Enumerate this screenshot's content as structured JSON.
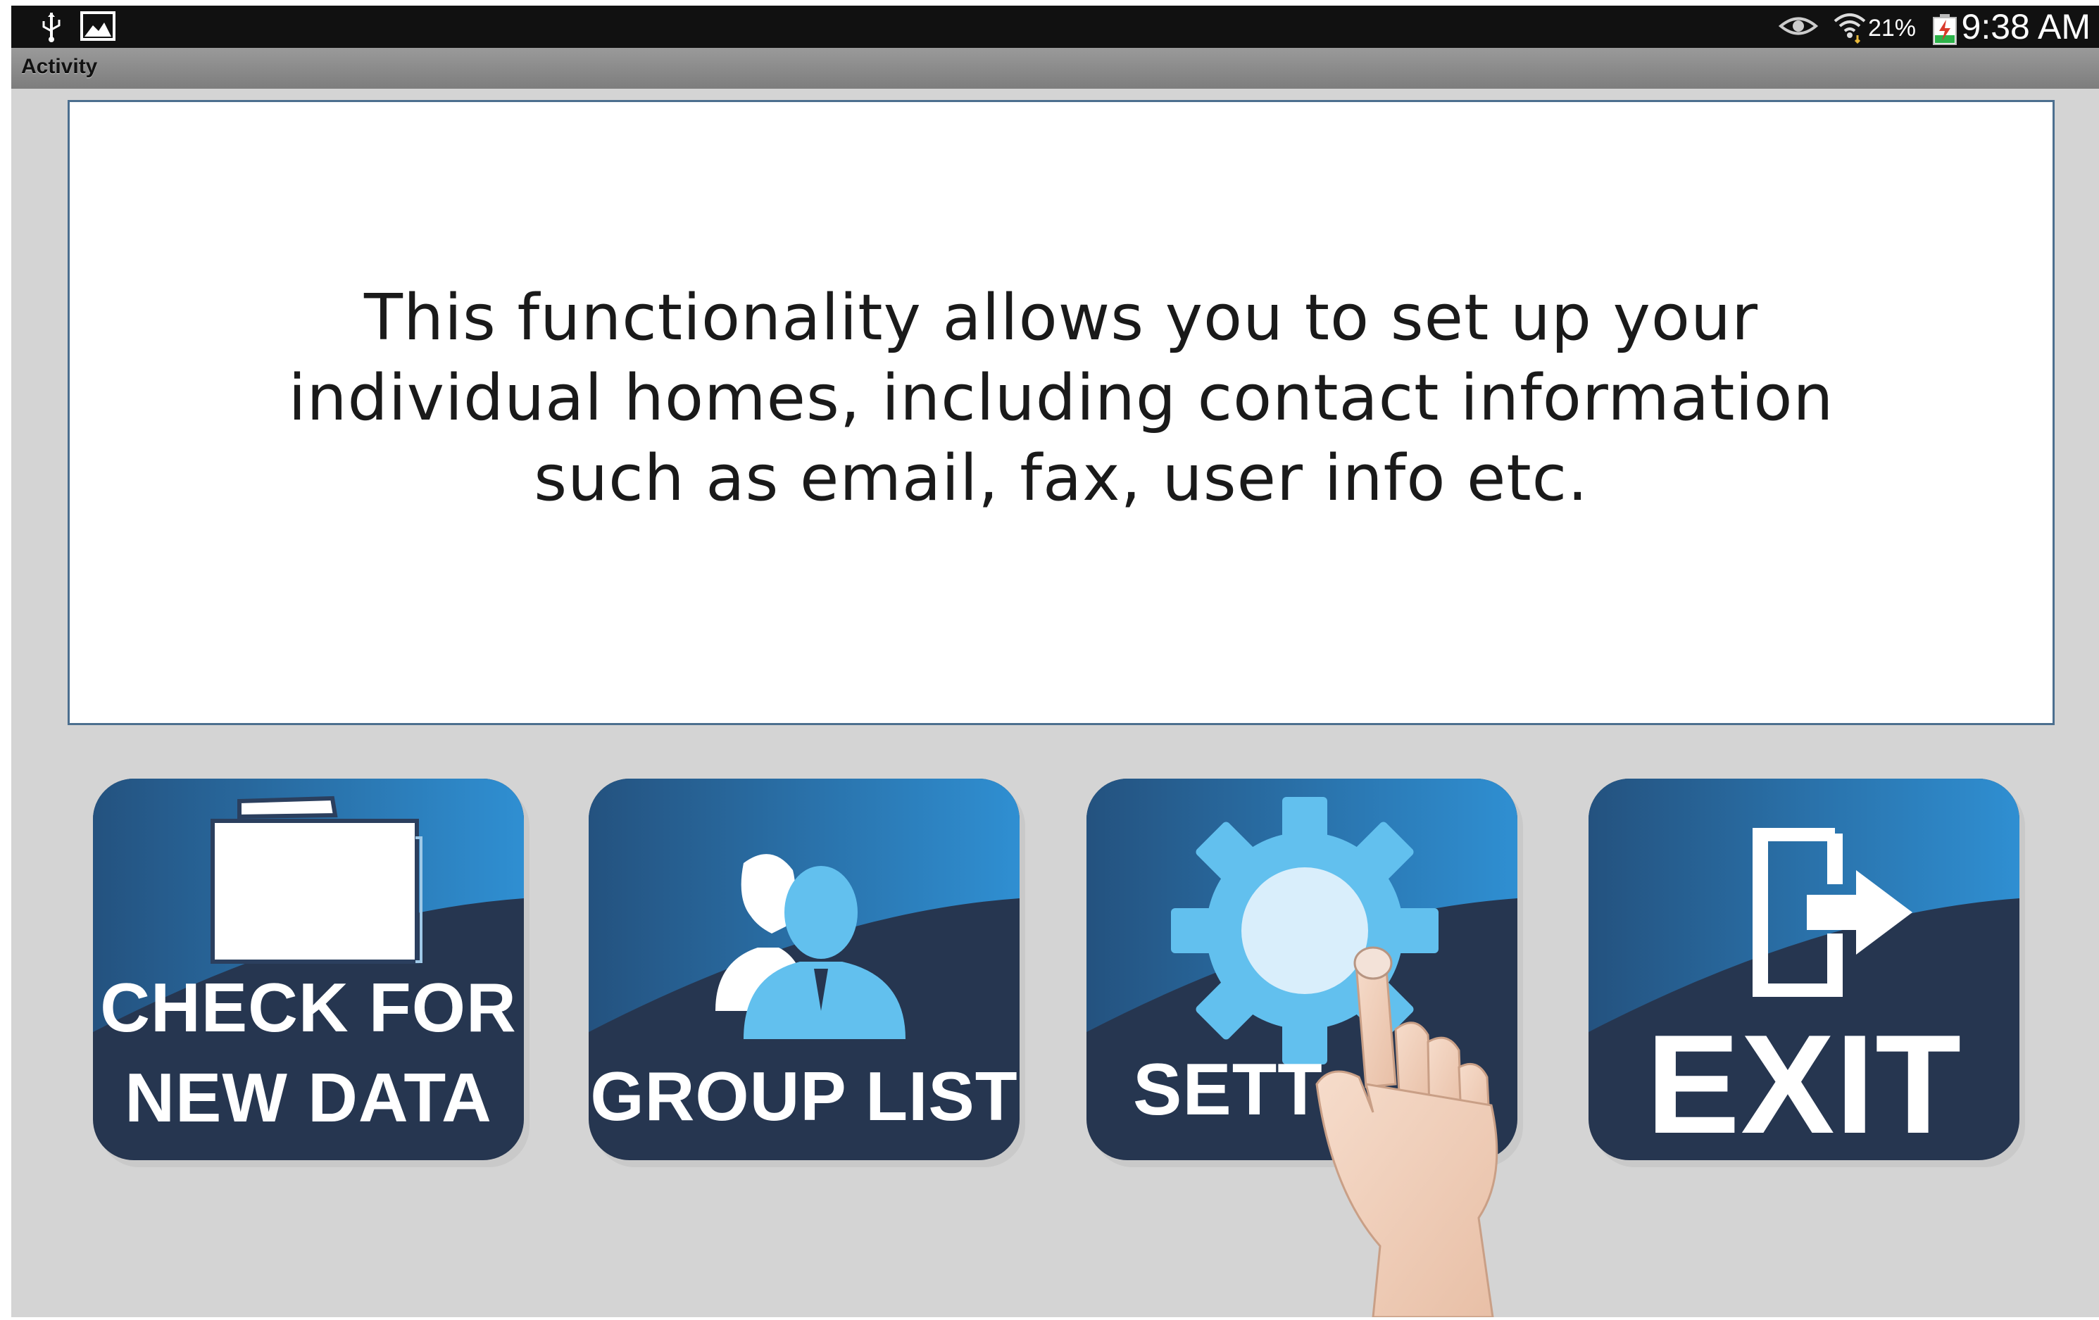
{
  "status_bar": {
    "battery_percent": "21%",
    "time": "9:38 AM",
    "icons": [
      "usb-icon",
      "image-notification-icon",
      "eye-icon",
      "wifi-icon",
      "battery-icon"
    ]
  },
  "title_bar": {
    "title": "Activity"
  },
  "info_panel": {
    "text": "This functionality allows you to set up your individual homes, including contact information such as email, fax, user info etc."
  },
  "tiles": {
    "check": {
      "line1": "CHECK FOR",
      "line2": "NEW DATA",
      "icon": "folder-icon"
    },
    "group": {
      "label": "GROUP LIST",
      "icon": "users-icon"
    },
    "settings": {
      "label": "SETT",
      "icon": "gear-icon"
    },
    "exit": {
      "label": "EXIT",
      "icon": "exit-door-icon"
    }
  },
  "colors": {
    "tile_dark": "#263650",
    "tile_blue": "#2d87c8",
    "icon_light_blue": "#62c0ee",
    "panel_border": "#4c6f8f",
    "content_bg": "#d4d4d4"
  }
}
